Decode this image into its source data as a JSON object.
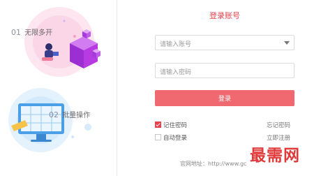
{
  "features": [
    {
      "num": "01",
      "label": "无限多开"
    },
    {
      "num": "02",
      "label": "批量操作"
    }
  ],
  "login": {
    "title": "登录账号",
    "account_placeholder": "请输入账号",
    "password_placeholder": "请输入密码",
    "submit_label": "登录",
    "remember_label": "记住密码",
    "remember_checked": true,
    "auto_login_label": "自动登录",
    "auto_login_checked": false,
    "forgot_label": "忘记密码",
    "register_label": "立即注册"
  },
  "footer": {
    "text": "官网地址：http://www.gc"
  },
  "watermark": {
    "text": "最需网"
  },
  "colors": {
    "accent": "#e8414c",
    "button": "#f06970",
    "cube": "#b63be0",
    "monitor": "#4a9fe6"
  }
}
